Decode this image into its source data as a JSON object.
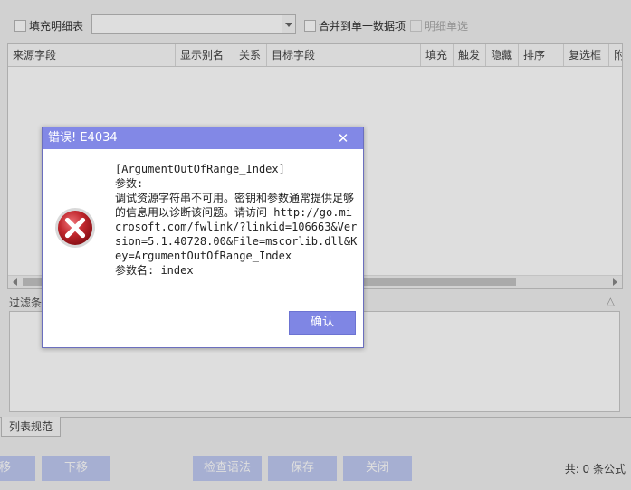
{
  "toolbar": {
    "fill_detail": "填充明细表",
    "merge_single": "合并到单一数据项",
    "detail_single_select": "明细单选"
  },
  "grid": {
    "columns": [
      "来源字段",
      "显示别名",
      "关系",
      "目标字段",
      "填充",
      "触发",
      "隐藏",
      "排序",
      "复选框",
      "附"
    ]
  },
  "filter": {
    "label": "过滤条件"
  },
  "tabs": {
    "list_spec": "列表规范"
  },
  "buttons": {
    "move_up": "移",
    "move_down": "下移",
    "check_syntax": "检查语法",
    "save": "保存",
    "close": "关闭"
  },
  "footer": {
    "total": "共:  0 条公式"
  },
  "dialog": {
    "title": "错误! E4034",
    "message": "[ArgumentOutOfRange_Index]\n参数:\n调试资源字符串不可用。密钥和参数通常提供足够的信息用以诊断该问题。请访问 http://go.microsoft.com/fwlink/?linkid=106663&Version=5.1.40728.00&File=mscorlib.dll&Key=ArgumentOutOfRange_Index\n参数名: index",
    "ok": "确认"
  },
  "colors": {
    "dialog_title_bg": "#8288e6",
    "ok_button_bg": "#7f86e4",
    "toolbar_button_bg": "#bfc9f2",
    "error_red": "#c0272d"
  }
}
